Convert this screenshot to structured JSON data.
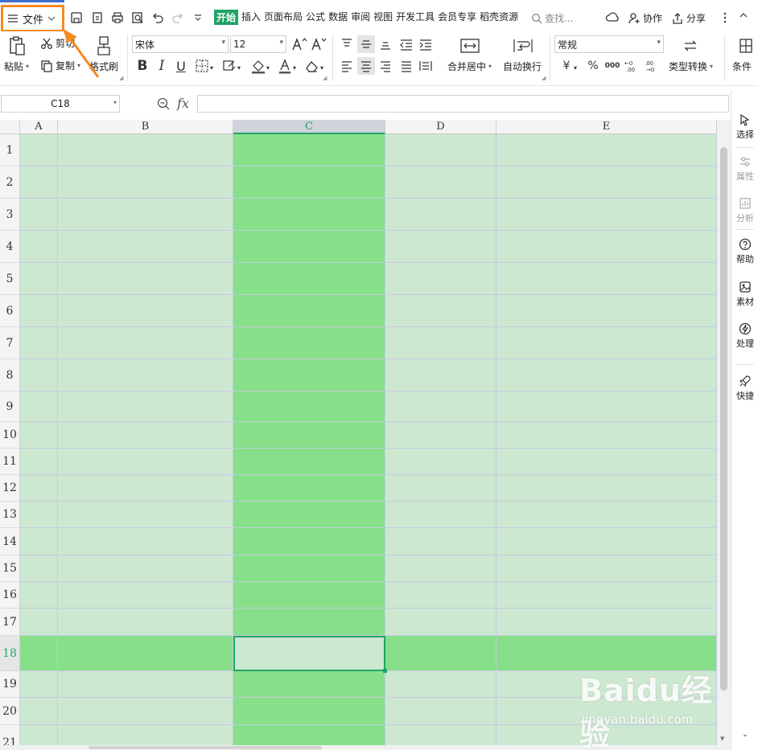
{
  "menu": {
    "file_label": "文件",
    "tabs": [
      {
        "label": "开始",
        "active": true
      },
      {
        "label": "插入",
        "active": false
      },
      {
        "label": "页面布局",
        "active": false
      },
      {
        "label": "公式",
        "active": false
      },
      {
        "label": "数据",
        "active": false
      },
      {
        "label": "审阅",
        "active": false
      },
      {
        "label": "视图",
        "active": false
      },
      {
        "label": "开发工具",
        "active": false
      },
      {
        "label": "会员专享",
        "active": false
      },
      {
        "label": "稻壳资源",
        "active": false
      }
    ],
    "search_placeholder": "查找...",
    "collab_label": "协作",
    "share_label": "分享"
  },
  "ribbon": {
    "paste": "粘贴",
    "cut": "剪切",
    "copy": "复制",
    "format_painter": "格式刷",
    "font_name": "宋体",
    "font_size": "12",
    "merge_center": "合并居中",
    "wrap_text": "自动换行",
    "number_format": "常规",
    "type_convert": "类型转换",
    "conditional": "条件"
  },
  "formula_bar": {
    "cell_ref": "C18",
    "fx_label": "fx",
    "formula": ""
  },
  "sheet": {
    "columns": [
      "A",
      "B",
      "C",
      "D",
      "E"
    ],
    "selected_column": "C",
    "rows": [
      "1",
      "2",
      "3",
      "4",
      "5",
      "6",
      "7",
      "8",
      "9",
      "10",
      "11",
      "12",
      "13",
      "14",
      "15",
      "16",
      "17",
      "18",
      "19",
      "20",
      "21"
    ],
    "selected_row": "18",
    "active_cell": "C18"
  },
  "right_panel": [
    {
      "label": "选择",
      "icon": "cursor-icon",
      "dim": false
    },
    {
      "label": "属性",
      "icon": "sliders-icon",
      "dim": true
    },
    {
      "label": "分析",
      "icon": "analysis-icon",
      "dim": true
    },
    {
      "label": "帮助",
      "icon": "help-icon",
      "dim": false
    },
    {
      "label": "素材",
      "icon": "material-icon",
      "dim": false
    },
    {
      "label": "处理",
      "icon": "process-icon",
      "dim": false
    },
    {
      "label": "快捷",
      "icon": "rocket-icon",
      "dim": false
    }
  ],
  "watermark": {
    "brand": "Baidu经验",
    "url": "jingyan.baidu.com"
  },
  "colors": {
    "accent": "#21a366",
    "highlight_cell": "#87e089",
    "cell_bg": "#cde8d1",
    "annotation": "#f58a1f"
  }
}
